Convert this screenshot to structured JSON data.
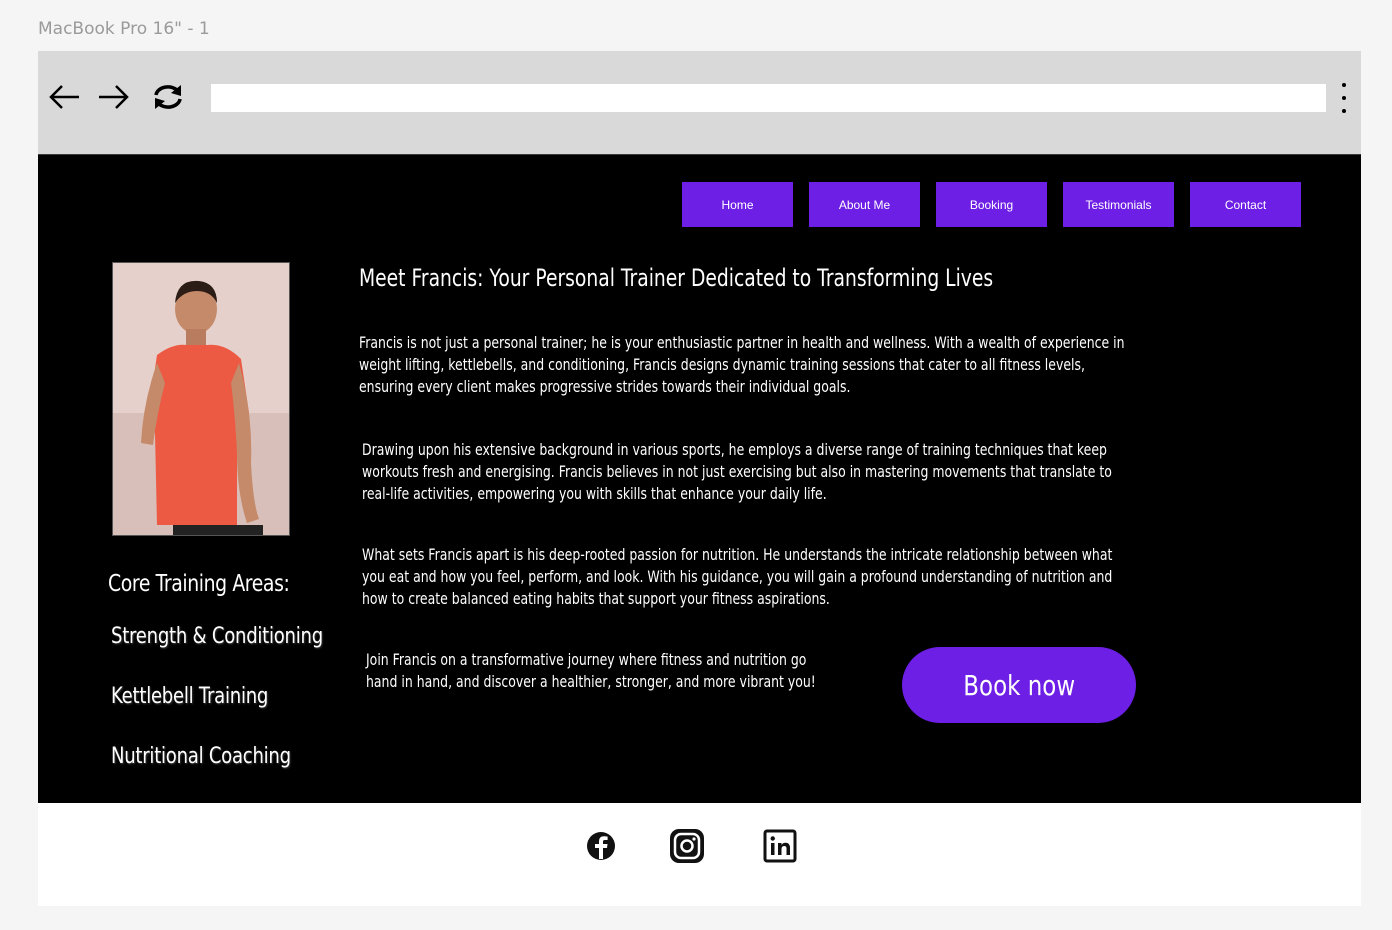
{
  "frame": {
    "label": "MacBook Pro 16\" - 1"
  },
  "browser": {
    "url_value": "",
    "icons": [
      "back-arrow-icon",
      "forward-arrow-icon",
      "refresh-icon",
      "kebab-menu-icon"
    ]
  },
  "nav": {
    "items": [
      {
        "label": "Home"
      },
      {
        "label": "About Me"
      },
      {
        "label": "Booking"
      },
      {
        "label": "Testimonials"
      },
      {
        "label": "Contact"
      }
    ]
  },
  "sidebar": {
    "core_title": "Core Training Areas:",
    "core_items": [
      {
        "label": "Strength & Conditioning"
      },
      {
        "label": "Kettlebell Training"
      },
      {
        "label": "Nutritional Coaching"
      }
    ]
  },
  "main": {
    "headline": "Meet Francis: Your Personal Trainer Dedicated to Transforming Lives",
    "paragraphs": [
      "Francis is not just a personal trainer; he is your enthusiastic partner in health and wellness. With a wealth of experience in weight lifting, kettlebells, and conditioning, Francis designs dynamic training sessions that cater to all fitness levels, ensuring every client makes progressive strides towards their individual goals.",
      "Drawing upon his extensive background in various sports, he employs a diverse range of training techniques that keep workouts fresh and energising. Francis believes in not just exercising but also in mastering movements that translate to real-life activities, empowering you with skills that enhance your daily life.",
      "What sets Francis apart is his deep-rooted passion for nutrition. He understands the intricate relationship between what you eat and how you feel, perform, and look. With his guidance, you will gain a profound understanding of nutrition and how to create balanced eating habits that support your fitness aspirations.",
      "Join Francis on a transformative journey where fitness and nutrition go hand in hand, and discover a healthier, stronger, and more vibrant you!"
    ],
    "book_button": "Book now"
  },
  "footer": {
    "social_icons": [
      "facebook-icon",
      "instagram-icon",
      "linkedin-icon"
    ]
  },
  "colors": {
    "accent": "#6e1fe6",
    "site_background": "#000000",
    "browser_bar": "#d9d9d9"
  }
}
